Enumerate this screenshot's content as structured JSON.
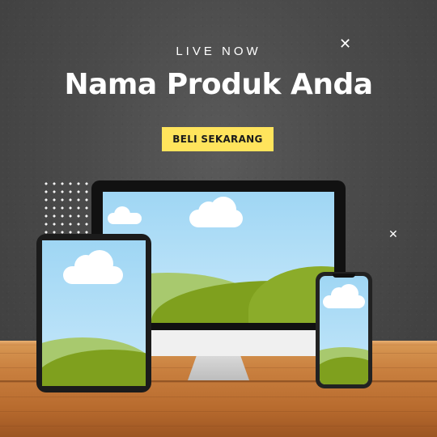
{
  "banner": {
    "eyebrow": "LIVE NOW",
    "title": "Nama Produk Anda",
    "cta_label": "BELI SEKARANG"
  },
  "colors": {
    "accent": "#ffe45c",
    "background": "#4a4a4a",
    "text": "#ffffff"
  },
  "icons": [
    "sparkle-icon",
    "sparkle-icon",
    "dot-grid-decoration"
  ]
}
